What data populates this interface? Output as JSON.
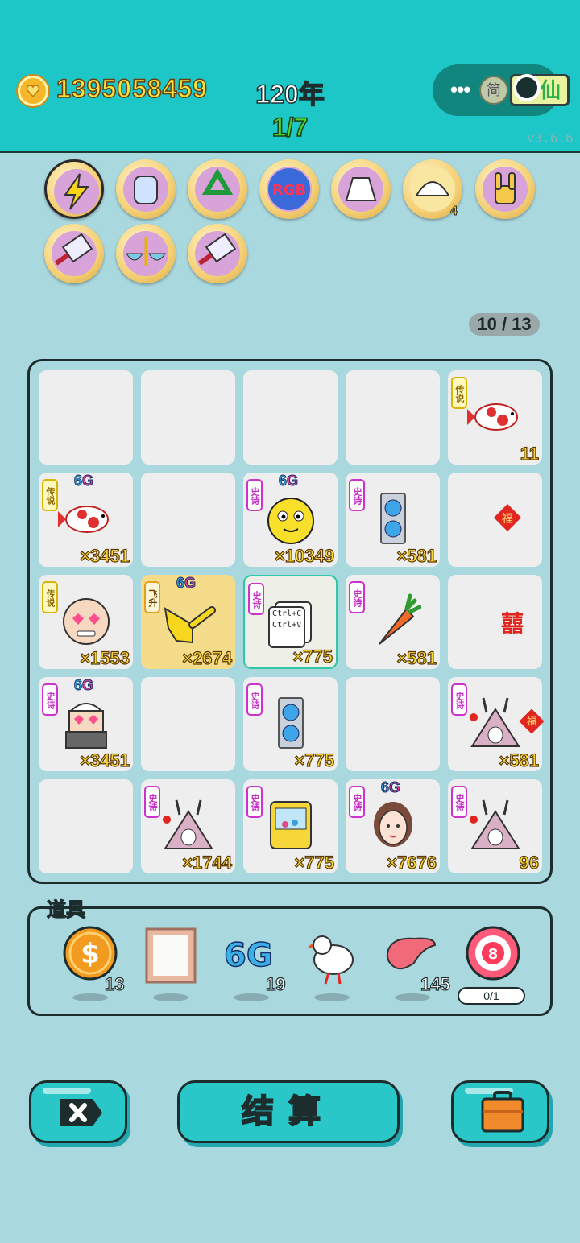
{
  "header": {
    "coins": "1395058459",
    "year": "120年",
    "round": "1/7",
    "capsule_jian": "简",
    "capsule_xian": "仙",
    "version": "v3.6.6"
  },
  "badges": [
    {
      "name": "lightning-icon",
      "label": ""
    },
    {
      "name": "jar-icon",
      "label": ""
    },
    {
      "name": "recycle-icon",
      "label": ""
    },
    {
      "name": "rgb-icon",
      "label": "RGB"
    },
    {
      "name": "skirt-icon",
      "label": ""
    },
    {
      "name": "shell-icon",
      "label": "4"
    },
    {
      "name": "rock-hand-icon",
      "label": ""
    },
    {
      "name": "cleaver-icon",
      "label": ""
    },
    {
      "name": "rice-bowl-up-icon",
      "label": ""
    },
    {
      "name": "cleaver-icon",
      "label": ""
    }
  ],
  "counter": "10 / 13",
  "grid": [
    [
      {
        "e": 1
      },
      {
        "e": 1
      },
      {
        "e": 1
      },
      {
        "e": 1
      },
      {
        "tag": "传说",
        "tagtype": "leg",
        "icon": "koi-fish-icon",
        "qty": "11"
      }
    ],
    [
      {
        "tag": "传说",
        "tagtype": "leg",
        "g6": "6G",
        "icon": "koi-fish-icon",
        "qty": "×3451"
      },
      {
        "e": 1
      },
      {
        "tag": "史诗",
        "g6": "6G",
        "icon": "yellow-face-icon",
        "qty": "×10349"
      },
      {
        "tag": "史诗",
        "icon": "graphics-card-icon",
        "qty": "×581"
      },
      {
        "icon": "fu-icon",
        "side": "福"
      }
    ],
    [
      {
        "tag": "传说",
        "tagtype": "leg",
        "icon": "heart-eyes-grandpa-icon",
        "qty": "×1553"
      },
      {
        "tag": "飞升",
        "tagtype": "fly",
        "g6": "6G",
        "icon": "pointing-hand-icon",
        "qty": "×2674",
        "gold": 1
      },
      {
        "tag": "史诗",
        "icon": "copy-paste-icon",
        "qty": "×775",
        "sel": 1,
        "ctrl1": "Ctrl+C",
        "ctrl2": "Ctrl+V"
      },
      {
        "tag": "史诗",
        "icon": "carrot-icon",
        "qty": "×581"
      },
      {
        "icon": "double-happiness-icon",
        "side": "囍"
      }
    ],
    [
      {
        "tag": "史诗",
        "g6": "6G",
        "icon": "cool-grandpa-icon",
        "qty": "×3451"
      },
      {
        "e": 1
      },
      {
        "tag": "史诗",
        "icon": "graphics-card-icon",
        "qty": "×775"
      },
      {
        "e": 1
      },
      {
        "tag": "史诗",
        "icon": "rabbit-tent-icon",
        "qty": "×581",
        "side": "福"
      }
    ],
    [
      {
        "e": 1
      },
      {
        "tag": "史诗",
        "icon": "rabbit-tent-icon",
        "qty": "×1744"
      },
      {
        "tag": "史诗",
        "icon": "claw-machine-icon",
        "qty": "×775"
      },
      {
        "tag": "史诗",
        "g6": "6G",
        "icon": "girl-portrait-icon",
        "qty": "×7676"
      },
      {
        "tag": "史诗",
        "icon": "rabbit-tent-icon",
        "qty": "96"
      }
    ]
  ],
  "props": {
    "title": "道具",
    "items": [
      {
        "name": "dollar-coin-icon",
        "count": "13"
      },
      {
        "name": "photo-frame-icon",
        "count": ""
      },
      {
        "name": "6g-icon",
        "count": "19",
        "text": "6G"
      },
      {
        "name": "white-bird-icon",
        "count": ""
      },
      {
        "name": "liver-icon",
        "count": "145"
      },
      {
        "name": "target-8-icon",
        "count": "",
        "text": "8",
        "bar": "0/1"
      }
    ]
  },
  "buttons": {
    "settle_label": "结算"
  }
}
